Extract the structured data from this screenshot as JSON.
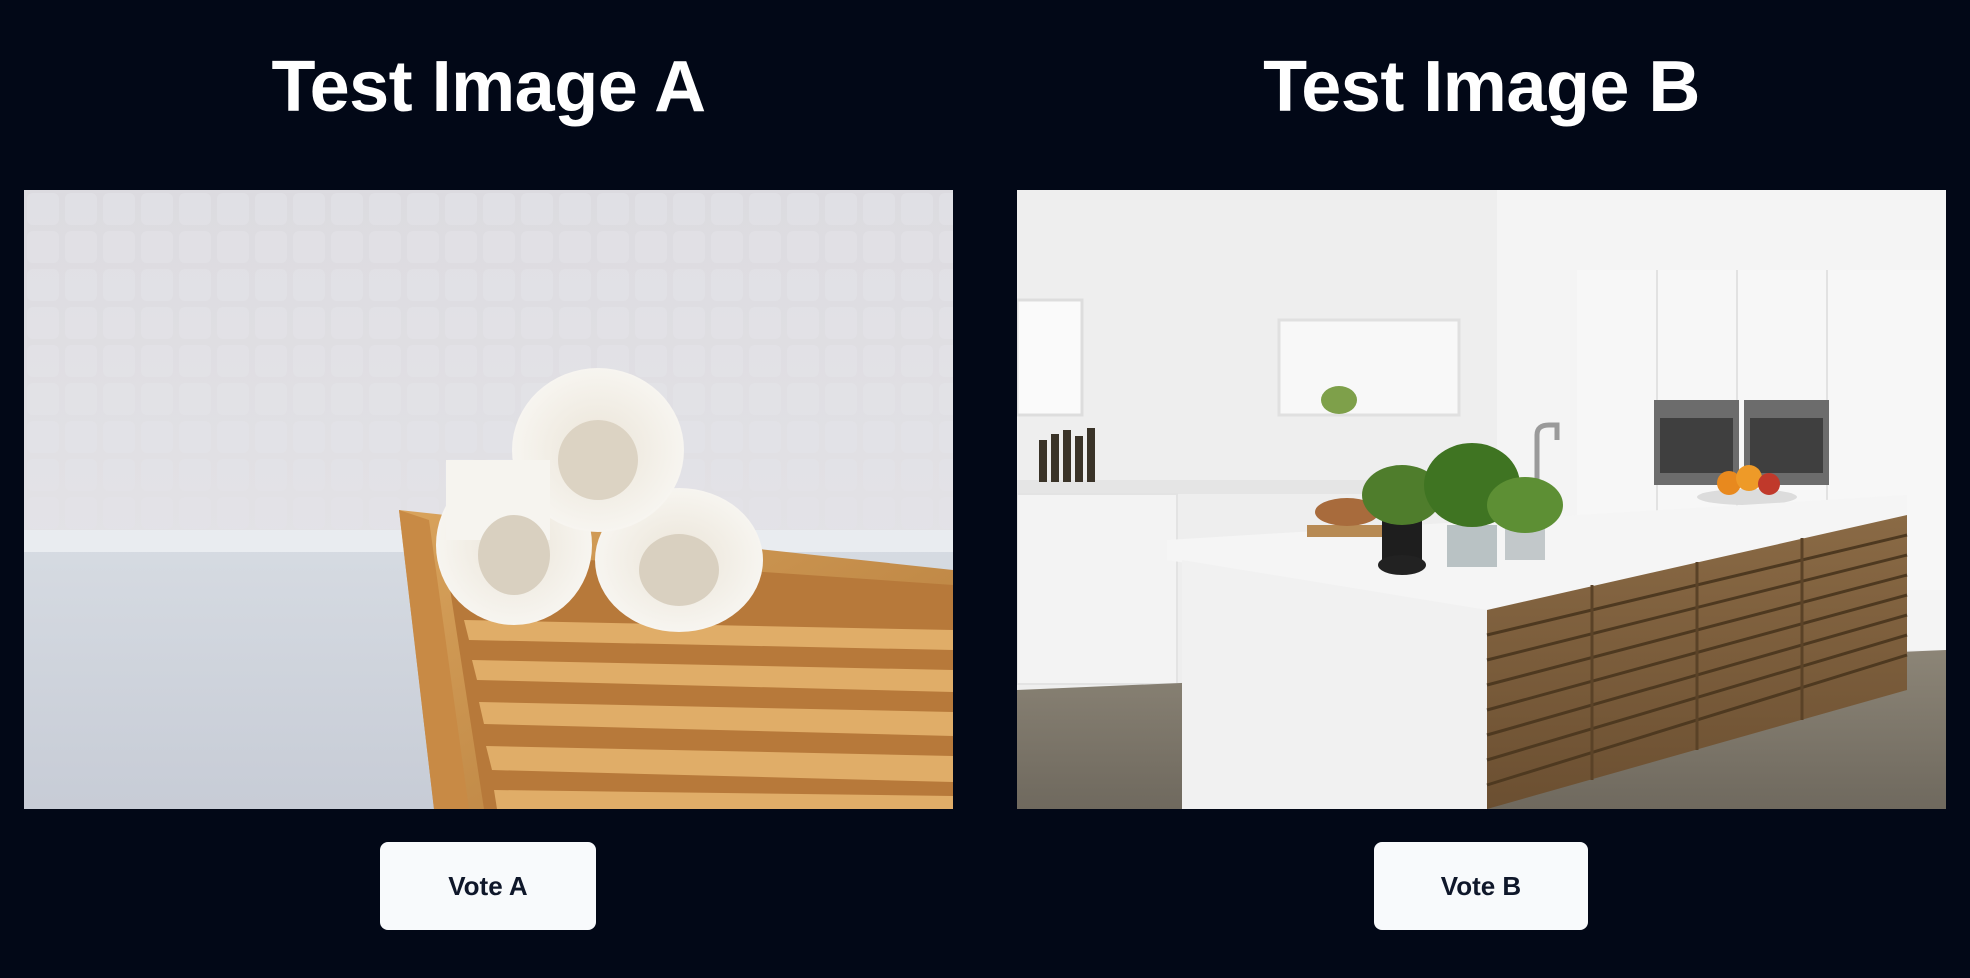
{
  "panels": {
    "a": {
      "title": "Test Image A",
      "vote_label": "Vote A",
      "image_subject": "rolled-towels-on-bath-caddy"
    },
    "b": {
      "title": "Test Image B",
      "vote_label": "Vote B",
      "image_subject": "white-kitchen-with-island"
    }
  },
  "colors": {
    "page_background": "#020817",
    "title_text": "#ffffff",
    "button_background": "#f8fafc",
    "button_text": "#0f172a"
  }
}
